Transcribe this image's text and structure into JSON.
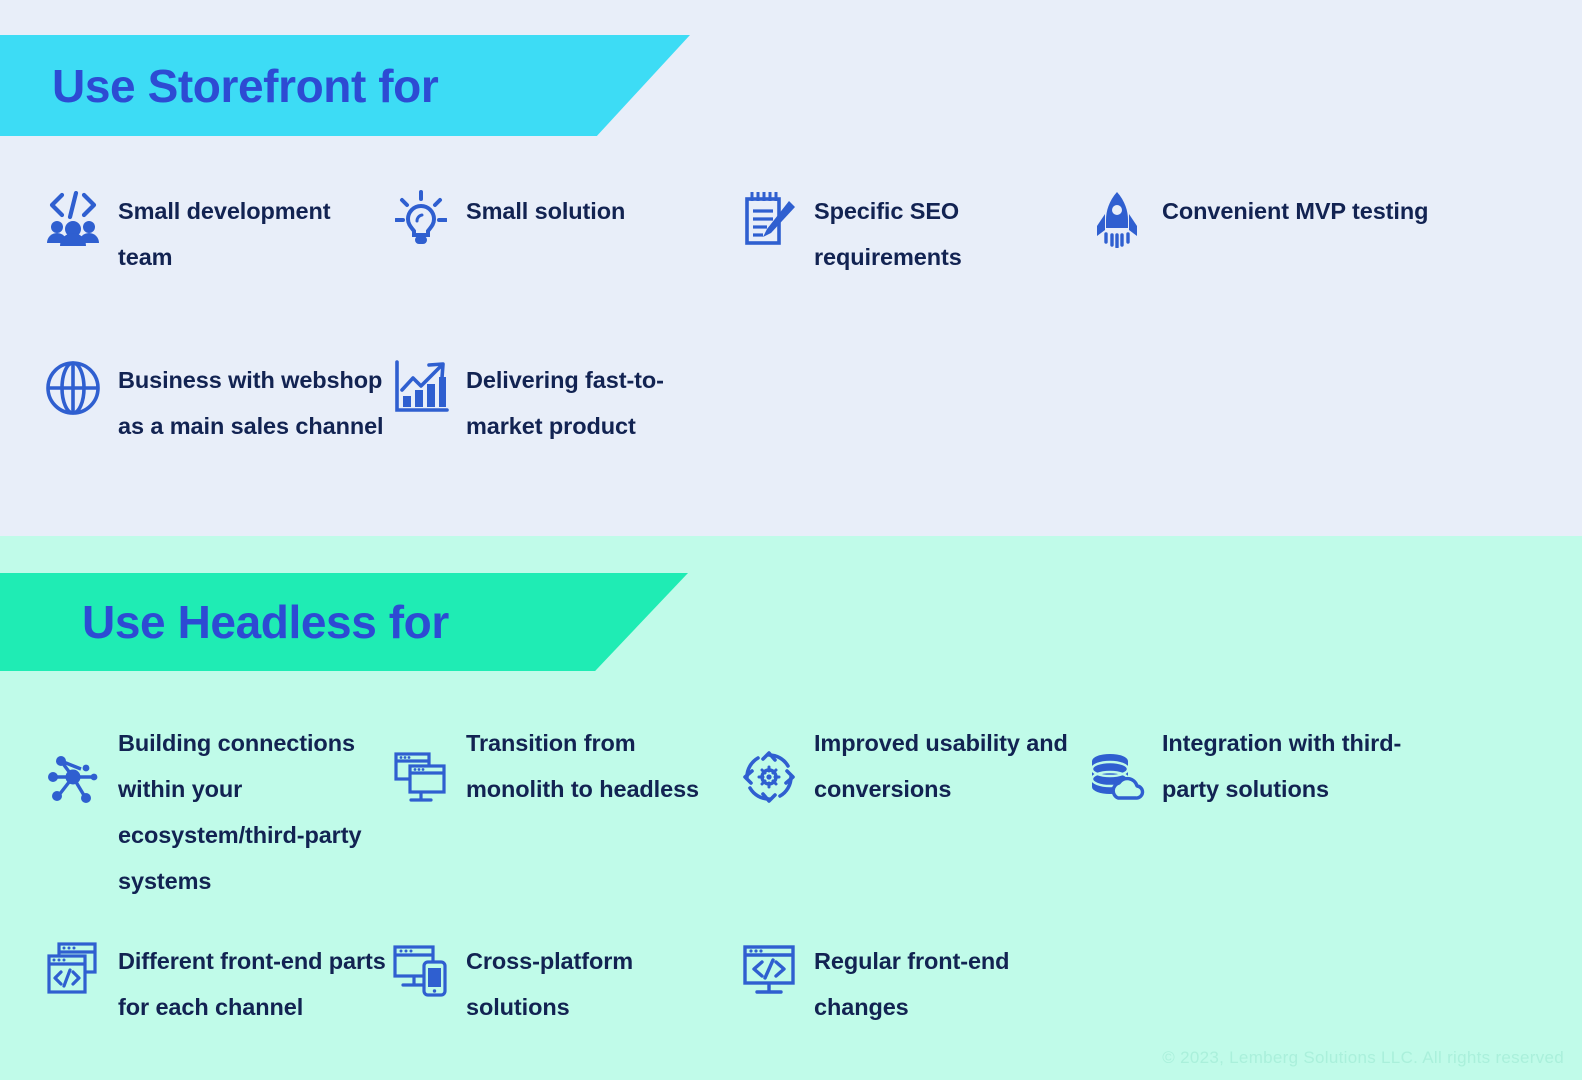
{
  "colors": {
    "storefront_bg": "#e8eef9",
    "headless_bg": "#c0fbe9",
    "storefront_ribbon": "#3ddcf5",
    "headless_ribbon": "#1fecb4",
    "title_text": "#2d4bd3",
    "body_text": "#122352",
    "icon_blue": "#2f5fd0",
    "footer_text": "#aaf0db"
  },
  "storefront": {
    "title": "Use Storefront for",
    "features": [
      {
        "icon": "code-team-icon",
        "label": "Small development team"
      },
      {
        "icon": "lightbulb-icon",
        "label": "Small solution"
      },
      {
        "icon": "notepad-pencil-icon",
        "label": "Specific SEO requirements"
      },
      {
        "icon": "rocket-icon",
        "label": "Convenient MVP testing"
      },
      {
        "icon": "globe-icon",
        "label": "Business with webshop as a main sales channel"
      },
      {
        "icon": "growth-chart-icon",
        "label": "Delivering fast-to-market product"
      }
    ]
  },
  "headless": {
    "title": "Use Headless for",
    "features": [
      {
        "icon": "network-nodes-icon",
        "label": "Building connections within your ecosystem/third-party systems"
      },
      {
        "icon": "monitor-windows-icon",
        "label": "Transition from monolith to headless"
      },
      {
        "icon": "gear-refresh-icon",
        "label": "Improved usability and conversions"
      },
      {
        "icon": "database-cloud-icon",
        "label": "Integration with third-party solutions"
      },
      {
        "icon": "browser-code-icon",
        "label": "Different front-end parts for each channel"
      },
      {
        "icon": "monitor-phone-icon",
        "label": "Cross-platform solutions"
      },
      {
        "icon": "monitor-code-icon",
        "label": "Regular front-end changes"
      }
    ]
  },
  "footer": {
    "copyright": "© 2023, Lemberg Solutions LLC. All rights reserved"
  }
}
